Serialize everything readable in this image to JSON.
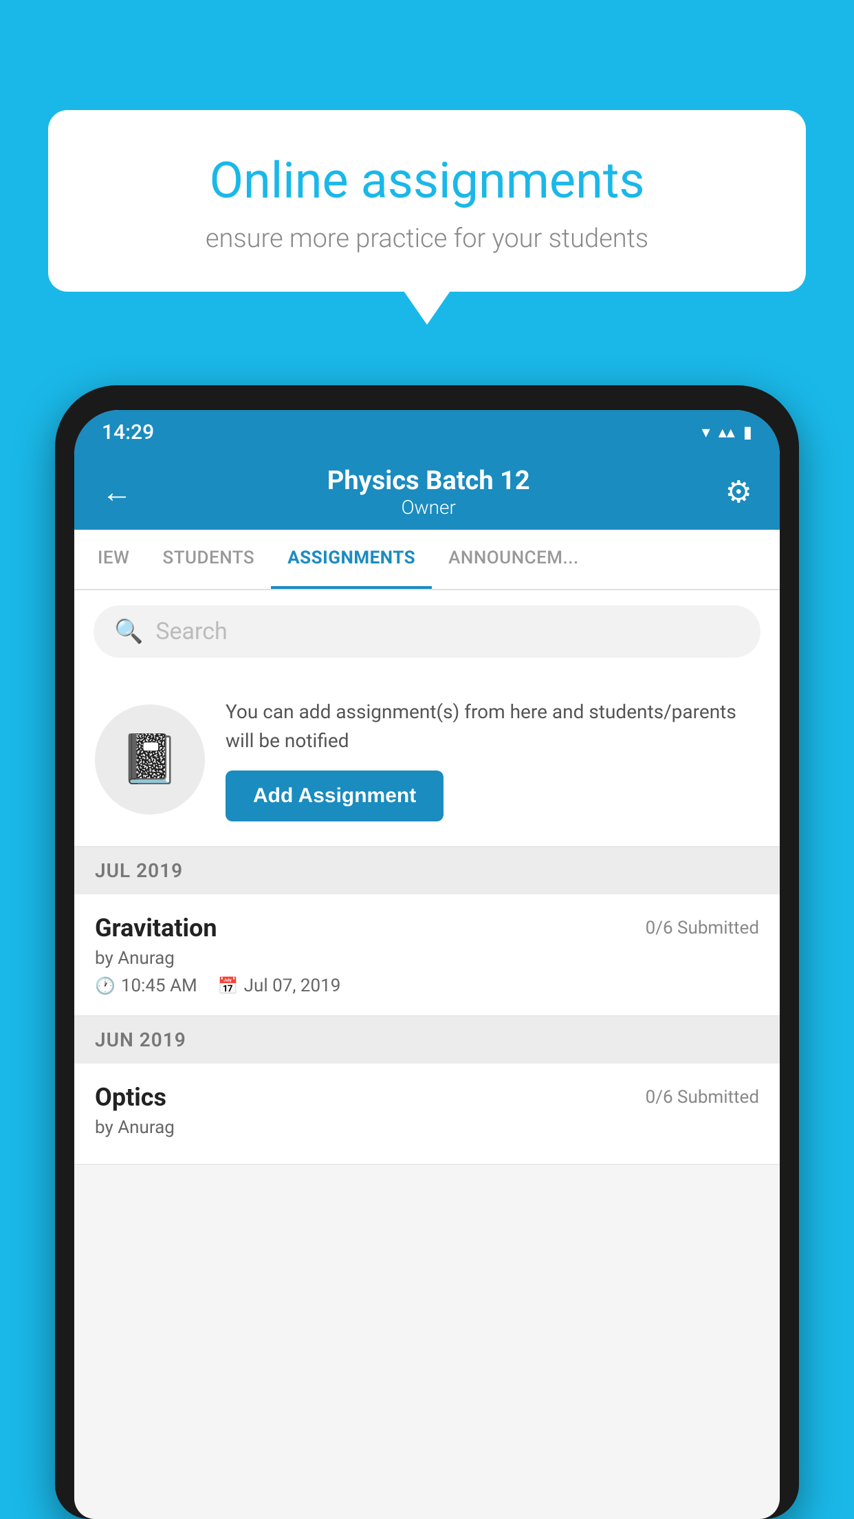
{
  "background_color": "#1ab8e8",
  "speech_bubble": {
    "title": "Online assignments",
    "subtitle": "ensure more practice for your students"
  },
  "status_bar": {
    "time": "14:29",
    "wifi": "▾",
    "signal": "▴▴",
    "battery": "▮"
  },
  "header": {
    "title": "Physics Batch 12",
    "subtitle": "Owner",
    "back_label": "←",
    "settings_label": "⚙"
  },
  "tabs": [
    {
      "label": "IEW",
      "active": false
    },
    {
      "label": "STUDENTS",
      "active": false
    },
    {
      "label": "ASSIGNMENTS",
      "active": true
    },
    {
      "label": "ANNOUNCEM...",
      "active": false
    }
  ],
  "search": {
    "placeholder": "Search"
  },
  "add_assignment_card": {
    "description": "You can add assignment(s) from here and students/parents will be notified",
    "button_label": "Add Assignment"
  },
  "sections": [
    {
      "label": "JUL 2019",
      "assignments": [
        {
          "name": "Gravitation",
          "submitted": "0/6 Submitted",
          "by": "by Anurag",
          "time": "10:45 AM",
          "date": "Jul 07, 2019"
        }
      ]
    },
    {
      "label": "JUN 2019",
      "assignments": [
        {
          "name": "Optics",
          "submitted": "0/6 Submitted",
          "by": "by Anurag",
          "time": "",
          "date": ""
        }
      ]
    }
  ]
}
